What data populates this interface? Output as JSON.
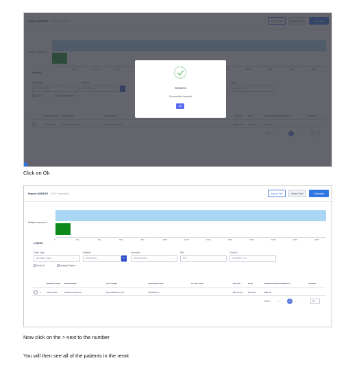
{
  "captions": {
    "first": "Click on Ok",
    "second": "Now click on the > next to the number",
    "third": "You will then see all of the patients in the remit"
  },
  "app": {
    "tab_import": "Import 835/837I",
    "tab_edi": "EDI Payments",
    "btn_import": "Import File",
    "btn_batch": "Batch Post",
    "btn_generate": "Generate",
    "chart_ylabel": "Multiple Insurance",
    "axis_ticks": [
      "0",
      "200",
      "400",
      "600",
      "800",
      "1000",
      "1200",
      "1400",
      "1600",
      "1800",
      "2000",
      "2200",
      "2400"
    ],
    "legend": "Legend",
    "filters": {
      "claim_type_label": "Claim Type",
      "claim_type_value": "All Claim Types",
      "patients_label": "Patients",
      "patients_value": "All Patients",
      "insurance_label": "Insurance",
      "insurance_value": "All Insurances",
      "ein_label": "EIN",
      "ein_value": "EIN",
      "check_label": "Check #",
      "check_value": "Check/EFT No",
      "chk_posted": "Post All",
      "chk_already_posted": "Already Posted"
    },
    "table": {
      "headers": [
        "IMPORT DATE",
        "INSURANCE",
        "FILE NAME",
        "CHECK/EFT NO",
        "CLAIM TYPE",
        "BILLED",
        "PAID",
        "PATIENT RESPONSIBILITY",
        "STATUS"
      ],
      "row": {
        "count": "1",
        "import_date": "01-02-2022",
        "insurance": "Multiple Insurance",
        "file_name": "import835remit.xml",
        "check_no": "CDO#147-1",
        "claim_type": "",
        "billed": "$2,970.00",
        "paid": "$720.00",
        "patient_resp": "$58.40",
        "status": ""
      },
      "pagination": {
        "total": "Total 1",
        "prev": "<",
        "current": "1",
        "next": ">",
        "size": "10"
      }
    }
  },
  "modal": {
    "title": "Success",
    "subtitle": "Successfully Imported",
    "ok": "Ok"
  },
  "chart_data": {
    "type": "bar",
    "categories": [
      "Multiple Insurance"
    ],
    "values": [
      110
    ],
    "xlim": [
      0,
      2400
    ]
  },
  "colors": {
    "accent": "#2f78e4",
    "bar_value": "#0e8a1d",
    "bar_background": "#a9d6f3",
    "modal_button": "#5a6cf0"
  }
}
